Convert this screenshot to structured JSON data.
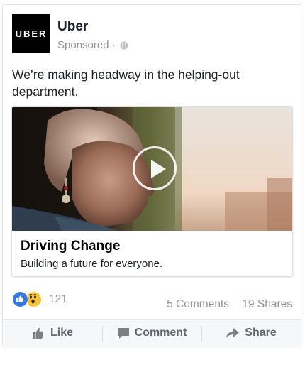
{
  "post": {
    "page_name": "Uber",
    "logo_text": "UBER",
    "sponsored_label": "Sponsored",
    "separator": "·",
    "privacy_icon": "globe-icon",
    "text": "We’re making headway in the helping-out department."
  },
  "link": {
    "title": "Driving Change",
    "description": "Building a future for everyone.",
    "play_icon": "play-icon"
  },
  "engagement": {
    "reaction_icons": [
      "like-reaction-icon",
      "wow-reaction-icon"
    ],
    "reaction_count": "121",
    "comments": "5 Comments",
    "shares": "19 Shares"
  },
  "actions": {
    "like": "Like",
    "comment": "Comment",
    "share": "Share"
  },
  "colors": {
    "like_blue": "#3578e5",
    "wow_yellow": "#f7c233",
    "muted_text": "#90949c",
    "action_text": "#606770"
  }
}
